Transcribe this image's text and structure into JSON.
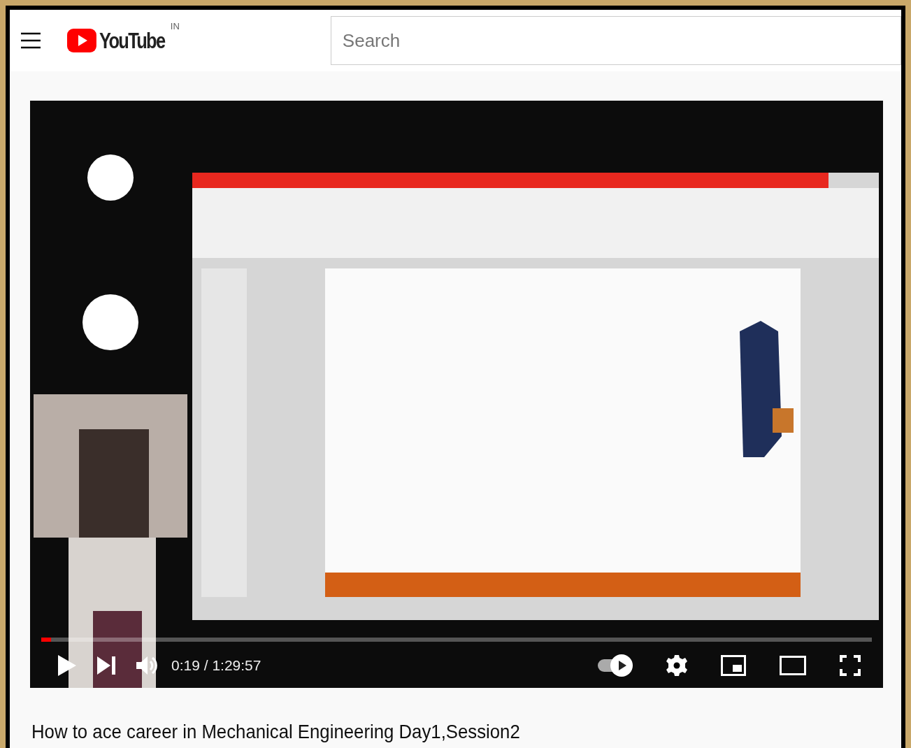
{
  "header": {
    "logo_text": "YouTube",
    "country": "IN",
    "search": {
      "placeholder": "Search"
    }
  },
  "player": {
    "progress": {
      "level": 0.012
    },
    "time": "0:19 / 1:29:57",
    "autoplay": {
      "on": true
    }
  },
  "title": "How to ace career in Mechanical Engineering Day1,Session2"
}
